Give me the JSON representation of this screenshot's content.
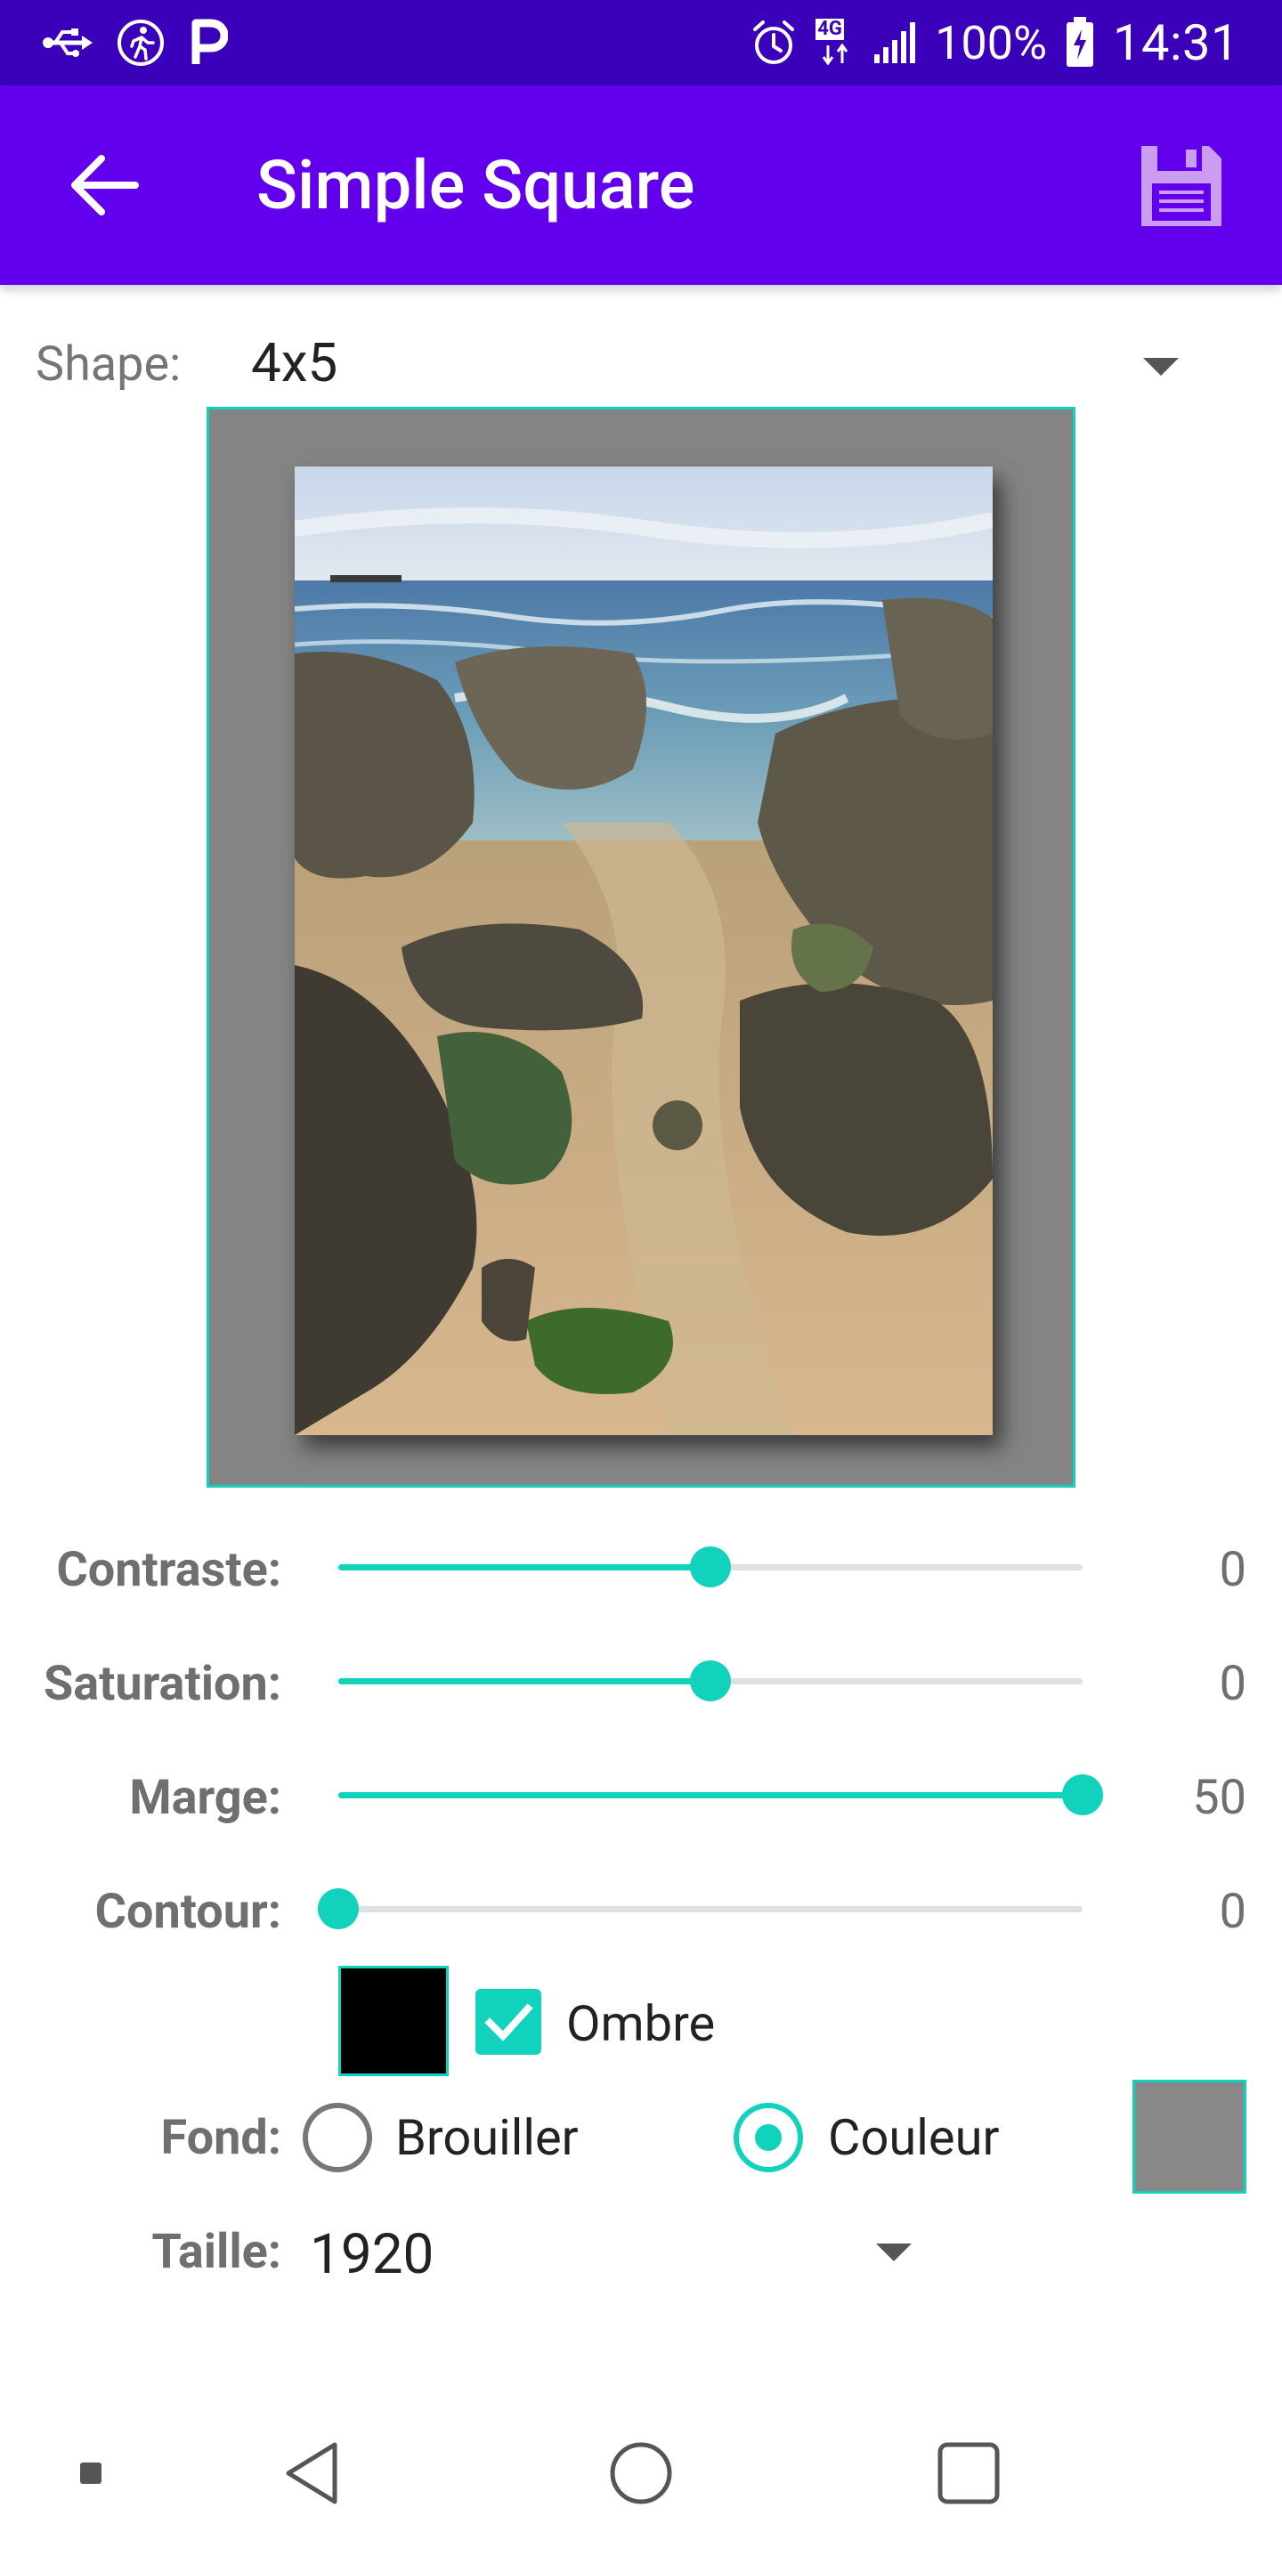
{
  "status_bar": {
    "time": "14:31",
    "battery": "100%",
    "network": "4G",
    "icons_left": [
      "usb-icon",
      "running-icon",
      "parking-icon"
    ],
    "icons_right": [
      "alarm-icon",
      "network-icon",
      "signal-icon",
      "battery-icon"
    ]
  },
  "appbar": {
    "title": "Simple Square",
    "color": "#6200ee",
    "status_color": "#3b00b9",
    "back_icon": "arrow-left-icon",
    "save_icon": "save-icon"
  },
  "shape": {
    "label": "Shape:",
    "value": "4x5"
  },
  "preview": {
    "background_color": "#848484",
    "border_color": "#11d3bd"
  },
  "sliders": [
    {
      "label": "Contraste:",
      "value": "0",
      "fraction": 0.5
    },
    {
      "label": "Saturation:",
      "value": "0",
      "fraction": 0.5
    },
    {
      "label": "Marge:",
      "value": "50",
      "fraction": 1.0
    },
    {
      "label": "Contour:",
      "value": "0",
      "fraction": 0.0
    }
  ],
  "accent_color": "#11d3bd",
  "ombre": {
    "label": "Ombre",
    "checked": true,
    "swatch_color": "#000000"
  },
  "fond": {
    "label": "Fond:",
    "options": [
      {
        "label": "Brouiller",
        "selected": false
      },
      {
        "label": "Couleur",
        "selected": true
      }
    ],
    "swatch_color": "#888888"
  },
  "taille": {
    "label": "Taille:",
    "value": "1920"
  },
  "navbar": {
    "buttons": [
      "dot-icon",
      "back-triangle-icon",
      "home-circle-icon",
      "recents-square-icon"
    ]
  }
}
